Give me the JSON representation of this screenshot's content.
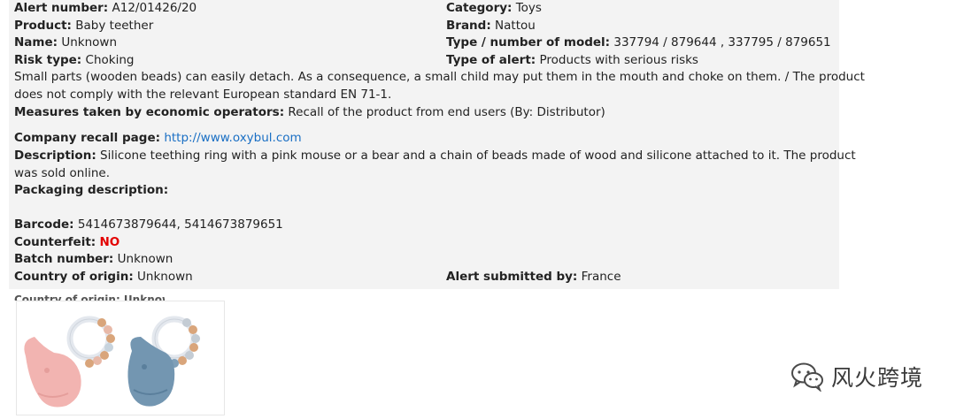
{
  "alert": {
    "alert_number_label": "Alert number:",
    "alert_number": "A12/01426/20",
    "category_label": "Category:",
    "category": "Toys",
    "product_label": "Product:",
    "product": "Baby teether",
    "brand_label": "Brand:",
    "brand": "Nattou",
    "name_label": "Name:",
    "name": "Unknown",
    "model_label": "Type / number of model:",
    "model": "337794 / 879644 , 337795 / 879651",
    "risk_type_label": "Risk type:",
    "risk_type": "Choking",
    "alert_type_label": "Type of alert:",
    "alert_type": "Products with serious risks",
    "risk_description_line1": "Small parts (wooden beads) can easily detach. As a consequence, a small child may put them in the mouth and choke on them. / The product",
    "risk_description_line2": "does not comply with the relevant European standard EN 71-1.",
    "measures_label": "Measures taken by economic operators:",
    "measures": "Recall of the product from end users (By: Distributor)",
    "recall_page_label": "Company recall page:",
    "recall_page_url": "http://www.oxybul.com",
    "description_label": "Description:",
    "description_line1": "Silicone teething ring with a pink mouse or a bear and a chain of beads made of wood and silicone attached to it. The product",
    "description_line2": "was sold online.",
    "packaging_label": "Packaging description:",
    "barcode_label": "Barcode:",
    "barcode": "5414673879644, 5414673879651",
    "counterfeit_label": "Counterfeit:",
    "counterfeit": "NO",
    "batch_label": "Batch number:",
    "batch": "Unknown",
    "origin_label": "Country of origin:",
    "origin": "Unknown",
    "submitted_label": "Alert submitted by:",
    "submitted": "France"
  },
  "cut_text": "Country of origin: Unknown",
  "watermark": {
    "text": "风火跨境",
    "icon": "wechat-icon"
  },
  "colors": {
    "panel_bg": "#f3f3f3",
    "link": "#1a6fc4",
    "counterfeit": "#e30000"
  }
}
